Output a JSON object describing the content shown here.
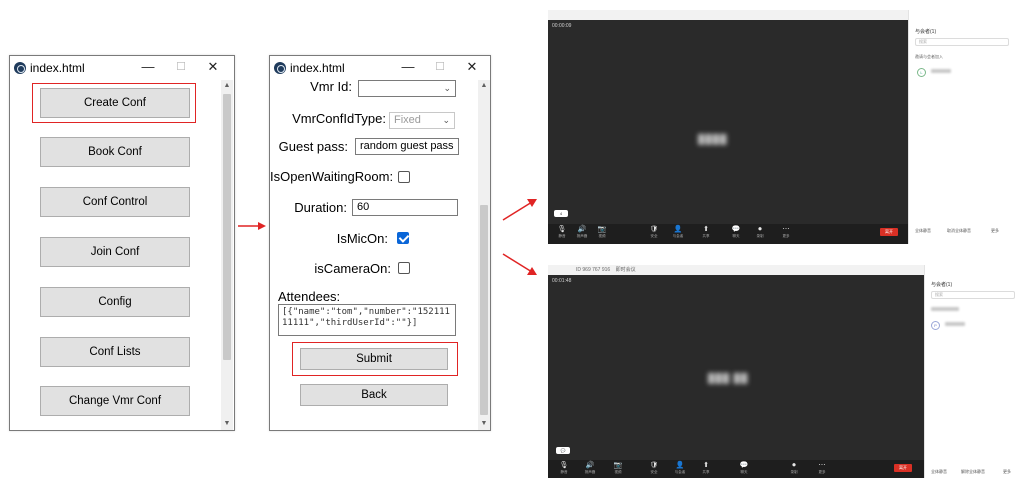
{
  "window1": {
    "title": "index.html",
    "buttons": [
      "Create Conf",
      "Book Conf",
      "Conf Control",
      "Join Conf",
      "Config",
      "Conf Lists",
      "Change Vmr Conf"
    ]
  },
  "window2": {
    "title": "index.html",
    "form": {
      "vmr_id_label": "Vmr Id:",
      "vmr_conf_id_type_label": "VmrConfIdType:",
      "vmr_conf_id_type_value": "Fixed",
      "guest_pass_label": "Guest pass:",
      "guest_pass_value": "random guest pass",
      "waiting_room_label": "IsOpenWaitingRoom:",
      "waiting_room_checked": false,
      "duration_label": "Duration:",
      "duration_value": "60",
      "mic_on_label": "IsMicOn:",
      "mic_on_checked": true,
      "camera_on_label": "isCameraOn:",
      "camera_on_checked": false,
      "attendees_label": "Attendees:",
      "attendees_value": "[{\"name\":\"tom\",\"number\":\"15211111111\",\"thirdUserId\":\"\"}]",
      "submit_label": "Submit",
      "back_label": "Back"
    }
  },
  "meeting1": {
    "timer": "00:00:09",
    "participants_title": "与会者(1)",
    "search_placeholder": "搜索",
    "invite_label": "邀请与会者加入",
    "participant_avatar_letter": "L",
    "chat_count": "4",
    "leave_label": "离开",
    "footer": [
      "全体静音",
      "取消全体静音",
      "更多"
    ],
    "tools": [
      "静音",
      "扬声器",
      "视频",
      "安全",
      "与会者",
      "共享",
      "聊天",
      "录制",
      "更多"
    ]
  },
  "meeting2": {
    "meeting_id": "ID 969 767 916",
    "title_suffix": "即时会议",
    "timer": "00:01:48",
    "participants_title": "与会者(1)",
    "search_placeholder": "搜索",
    "participant_avatar_letter": "P",
    "leave_label": "离开",
    "footer": [
      "全体静音",
      "解除全体静音",
      "更多"
    ],
    "tools": [
      "静音",
      "扬声器",
      "视频",
      "安全",
      "与会者",
      "共享",
      "聊天",
      "录制",
      "更多"
    ]
  },
  "colors": {
    "highlight": "#e02424",
    "arrow": "#e02424",
    "checkbox_on": "#0a66d8",
    "meeting_bg": "#2a2a2a"
  }
}
